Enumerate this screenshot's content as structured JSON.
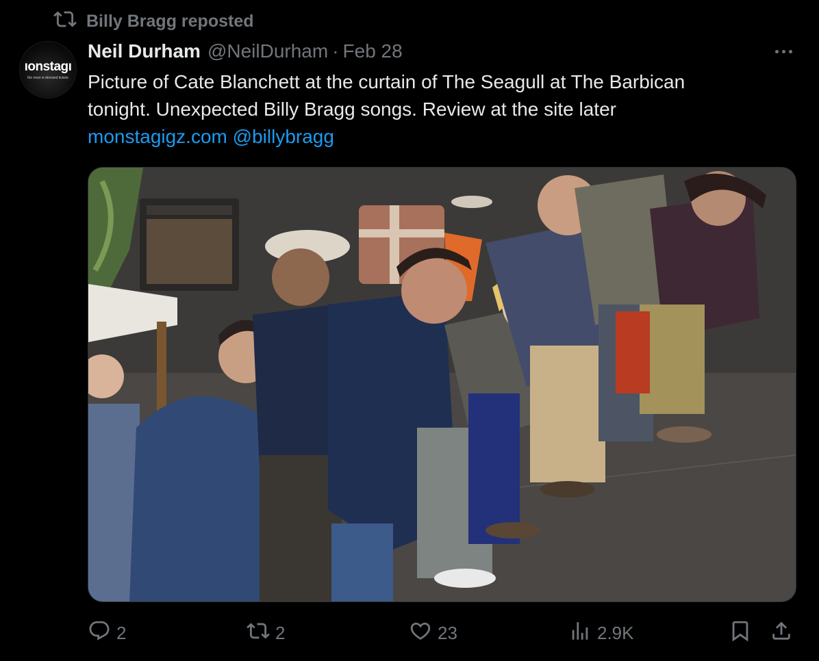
{
  "repost": {
    "label": "Billy Bragg reposted",
    "icon": "repost-icon"
  },
  "avatar": {
    "logo_text": "ıonstagı",
    "logo_sub": "the most in-demand tickets"
  },
  "author": {
    "name": "Neil Durham",
    "handle": "@NeilDurham",
    "separator": "·",
    "date": "Feb 28"
  },
  "post": {
    "line1": "Picture of Cate Blanchett at the curtain of The Seagull at The Barbican",
    "line2": "tonight. Unexpected Billy Bragg songs. Review at the site later",
    "link_site": "monstagigz.com",
    "link_mention": "@billybragg"
  },
  "stats": {
    "replies": "2",
    "reposts": "2",
    "likes": "23",
    "views": "2.9K"
  },
  "colors": {
    "background": "#000000",
    "text": "#e7e9ea",
    "muted": "#71767b",
    "link": "#1d9bf0"
  }
}
